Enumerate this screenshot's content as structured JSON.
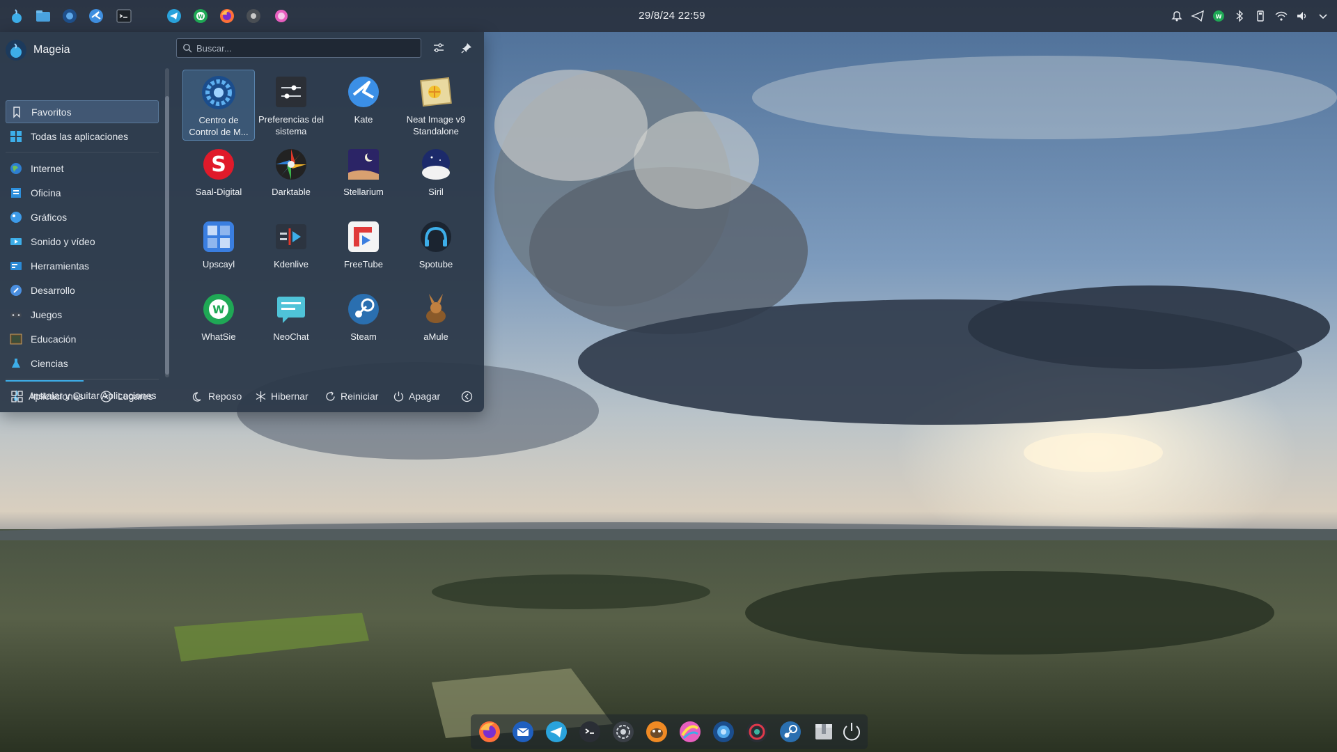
{
  "panel": {
    "clock": "29/8/24 22:59",
    "launcher_icon": "mageia-launcher-icon",
    "tasks": [
      "file-manager-icon",
      "control-center-icon",
      "kate-icon",
      "terminal-icon",
      "telegram-icon",
      "whatsie-icon",
      "firefox-icon",
      "darktable-icon",
      "app-icon"
    ],
    "tray": [
      "alarm-icon",
      "telegram-tray-icon",
      "whatsie-tray-icon",
      "bluetooth-icon",
      "usb-device-icon",
      "wifi-icon",
      "volume-icon",
      "expand-tray-icon"
    ]
  },
  "launcher": {
    "user_name": "Mageia",
    "search": {
      "placeholder": "Buscar..."
    },
    "categories": [
      {
        "label": "Favoritos",
        "icon": "bookmark-icon",
        "active": true
      },
      {
        "label": "Todas las aplicaciones",
        "icon": "grid-icon"
      },
      {
        "label": "Internet",
        "icon": "globe-icon"
      },
      {
        "label": "Oficina",
        "icon": "office-icon"
      },
      {
        "label": "Gráficos",
        "icon": "graphics-icon"
      },
      {
        "label": "Sonido y vídeo",
        "icon": "multimedia-icon"
      },
      {
        "label": "Herramientas",
        "icon": "tools-icon"
      },
      {
        "label": "Desarrollo",
        "icon": "development-icon"
      },
      {
        "label": "Juegos",
        "icon": "gamepad-icon"
      },
      {
        "label": "Educación",
        "icon": "education-icon"
      },
      {
        "label": "Ciencias",
        "icon": "science-icon"
      },
      {
        "label": "Instalar y Quitar Aplicaciones",
        "icon": "install-icon"
      }
    ],
    "apps": [
      {
        "label": "Centro de Control de M...",
        "icon": "control-center-icon",
        "selected": true
      },
      {
        "label": "Preferencias del sistema",
        "icon": "system-settings-icon"
      },
      {
        "label": "Kate",
        "icon": "kate-icon"
      },
      {
        "label": "Neat Image v9 Standalone",
        "icon": "neat-image-icon"
      },
      {
        "label": "Saal-Digital",
        "icon": "saal-digital-icon"
      },
      {
        "label": "Darktable",
        "icon": "darktable-icon"
      },
      {
        "label": "Stellarium",
        "icon": "stellarium-icon"
      },
      {
        "label": "Siril",
        "icon": "siril-icon"
      },
      {
        "label": "Upscayl",
        "icon": "upscayl-icon"
      },
      {
        "label": "Kdenlive",
        "icon": "kdenlive-icon"
      },
      {
        "label": "FreeTube",
        "icon": "freetube-icon"
      },
      {
        "label": "Spotube",
        "icon": "spotube-icon"
      },
      {
        "label": "WhatSie",
        "icon": "whatsie-icon"
      },
      {
        "label": "NeoChat",
        "icon": "neochat-icon"
      },
      {
        "label": "Steam",
        "icon": "steam-icon"
      },
      {
        "label": "aMule",
        "icon": "amule-icon"
      }
    ],
    "footer": {
      "tabs": [
        {
          "label": "Aplicaciones",
          "icon": "apps-grid-icon",
          "active": true
        },
        {
          "label": "Lugares",
          "icon": "compass-icon"
        }
      ],
      "power": [
        {
          "label": "Reposo",
          "icon": "sleep-icon"
        },
        {
          "label": "Hibernar",
          "icon": "hibernate-icon"
        },
        {
          "label": "Reiniciar",
          "icon": "restart-icon"
        },
        {
          "label": "Apagar",
          "icon": "shutdown-icon"
        }
      ],
      "more": "more-options-icon"
    }
  },
  "dock": [
    "firefox-icon",
    "thunderbird-icon",
    "telegram-icon",
    "terminal-icon",
    "camera-aperture-icon",
    "gimp-icon",
    "krita-icon",
    "control-center-icon",
    "davinci-icon",
    "steam-icon",
    "archive-icon",
    "power-icon"
  ],
  "colors": {
    "accent": "#3daee9",
    "panel": "#262c38",
    "launcher": "#2c3848"
  }
}
